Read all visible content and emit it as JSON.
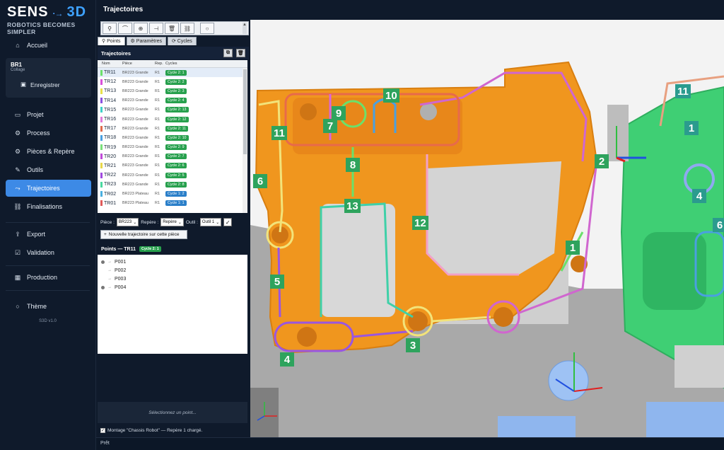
{
  "app": {
    "logo_sens": "SENS",
    "logo_3d": "3D",
    "logo_arrow": "·→",
    "tagline": "ROBOTICS BECOMES SIMPLER",
    "page_title": "Trajectoires",
    "version": "S3D v1.0",
    "status": "Prêt"
  },
  "sidebar": {
    "accueil": "Accueil",
    "robot_name": "BR1",
    "robot_sub": "Collage",
    "save": "Enregistrer",
    "items": [
      {
        "label": "Projet",
        "icon": "folder-icon"
      },
      {
        "label": "Process",
        "icon": "gear-icon"
      },
      {
        "label": "Pièces & Repère",
        "icon": "settings-icon"
      },
      {
        "label": "Outils",
        "icon": "wrench-icon"
      },
      {
        "label": "Trajectoires",
        "icon": "path-icon"
      },
      {
        "label": "Finalisations",
        "icon": "link-icon"
      }
    ],
    "export": "Export",
    "validation": "Validation",
    "production": "Production",
    "theme": "Thème"
  },
  "toolbar": {
    "tools": [
      "⚲",
      "⌒",
      "⊕",
      "⊣",
      "🗑",
      "⛓",
      "○"
    ]
  },
  "tabs": [
    "Points",
    "Paramètres",
    "Cycles"
  ],
  "trajectoires": {
    "title": "Trajectoires",
    "columns": [
      "Nom",
      "Pièce",
      "Rep.",
      "Cycles"
    ],
    "rows": [
      {
        "nom": "TR11",
        "piece": "BR223 Grande",
        "rep": "R1",
        "cycle": "Cycle 2: 1",
        "color": "#6be06b",
        "badge": "#27a04d"
      },
      {
        "nom": "TR12",
        "piece": "BR223 Grande",
        "rep": "R1",
        "cycle": "Cycle 2: 2",
        "color": "#d94fd9",
        "badge": "#27a04d"
      },
      {
        "nom": "TR13",
        "piece": "BR223 Grande",
        "rep": "R1",
        "cycle": "Cycle 2: 3",
        "color": "#e8e04a",
        "badge": "#27a04d"
      },
      {
        "nom": "TR14",
        "piece": "BR223 Grande",
        "rep": "R1",
        "cycle": "Cycle 2: 4",
        "color": "#8b4fe0",
        "badge": "#27a04d"
      },
      {
        "nom": "TR15",
        "piece": "BR223 Grande",
        "rep": "R1",
        "cycle": "Cycle 2: 13",
        "color": "#3fd0c8",
        "badge": "#27a04d"
      },
      {
        "nom": "TR16",
        "piece": "BR223 Grande",
        "rep": "R1",
        "cycle": "Cycle 2: 12",
        "color": "#e07ad9",
        "badge": "#27a04d"
      },
      {
        "nom": "TR17",
        "piece": "BR223 Grande",
        "rep": "R1",
        "cycle": "Cycle 2: 11",
        "color": "#e06a4a",
        "badge": "#27a04d"
      },
      {
        "nom": "TR18",
        "piece": "BR223 Grande",
        "rep": "R1",
        "cycle": "Cycle 2: 10",
        "color": "#4aa0e0",
        "badge": "#27a04d"
      },
      {
        "nom": "TR19",
        "piece": "BR223 Grande",
        "rep": "R1",
        "cycle": "Cycle 2: 9",
        "color": "#7ae07a",
        "badge": "#27a04d"
      },
      {
        "nom": "TR20",
        "piece": "BR223 Grande",
        "rep": "R1",
        "cycle": "Cycle 2: 7",
        "color": "#c04ad9",
        "badge": "#27a04d"
      },
      {
        "nom": "TR21",
        "piece": "BR223 Grande",
        "rep": "R1",
        "cycle": "Cycle 2: 6",
        "color": "#e8d84a",
        "badge": "#27a04d"
      },
      {
        "nom": "TR22",
        "piece": "BR223 Grande",
        "rep": "R1",
        "cycle": "Cycle 2: 5",
        "color": "#a04ae0",
        "badge": "#27a04d"
      },
      {
        "nom": "TR23",
        "piece": "BR223 Grande",
        "rep": "R1",
        "cycle": "Cycle 2: 8",
        "color": "#4ad9a0",
        "badge": "#27a04d"
      },
      {
        "nom": "TR02",
        "piece": "BR223 Plateau",
        "rep": "R1",
        "cycle": "Cycle 1: 2",
        "color": "#4ab0e0",
        "badge": "#2a7fc9"
      },
      {
        "nom": "TR01",
        "piece": "BR223 Plateau",
        "rep": "R1",
        "cycle": "Cycle 1: 1",
        "color": "#e05a5a",
        "badge": "#2a7fc9"
      }
    ]
  },
  "filters": {
    "piece_label": "Pièce :",
    "piece_value": "BR223",
    "repere_label": "Repère :",
    "repere_value": "Repère",
    "outil_label": "Outil :",
    "outil_value": "Outil 1",
    "new_button": "Nouvelle trajectoire sur cette pièce"
  },
  "points": {
    "title": "Points — TR11",
    "cycle_badge": "Cycle 2: 1",
    "items": [
      {
        "name": "P001",
        "marker": true
      },
      {
        "name": "P002",
        "marker": false
      },
      {
        "name": "P003",
        "marker": false
      },
      {
        "name": "P004",
        "marker": true
      }
    ]
  },
  "select_message": "Sélectionnez un point...",
  "montage_status": "Montage \"Chassis Robot\" — Repère 1 chargé.",
  "viewport": {
    "left_labels": [
      "1",
      "2",
      "3",
      "4",
      "5",
      "6",
      "7",
      "8",
      "9",
      "10",
      "11",
      "12",
      "13"
    ],
    "right_labels": [
      "11",
      "1",
      "4",
      "6"
    ]
  },
  "colors": {
    "accent": "#3d8ae6",
    "part_orange": "#f0961e",
    "part_green": "#3fcf74",
    "label_green": "#2ea35d"
  }
}
